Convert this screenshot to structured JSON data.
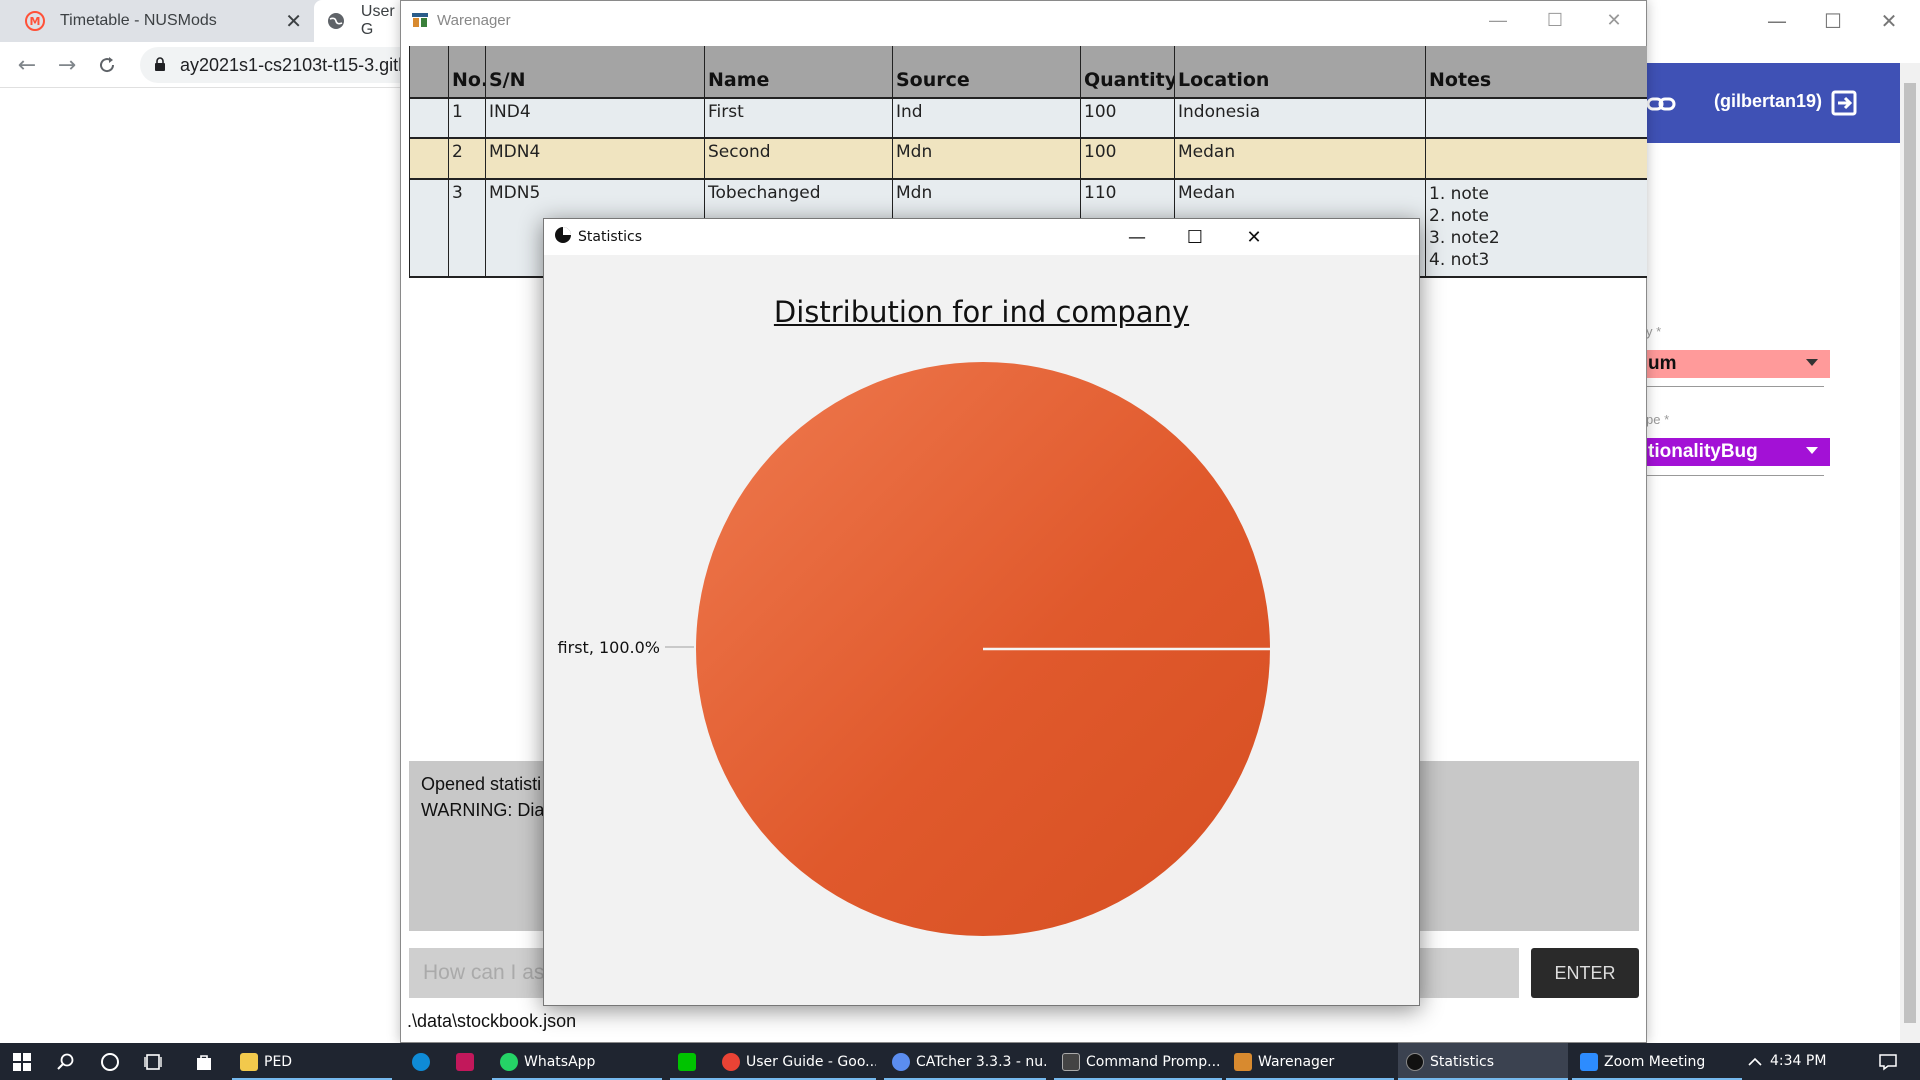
{
  "browser": {
    "tabs": [
      {
        "title": "Timetable - NUSMods",
        "close": "✕"
      },
      {
        "title": "User G"
      }
    ],
    "url": "ay2021s1-cs2103t-t15-3.githu",
    "github": {
      "user": "(gilbertan19)",
      "field1_label": "y *",
      "field1_value": "um",
      "field1_color": "#ff9a9a",
      "field2_label": "pe *",
      "field2_value": "tionalityBug",
      "field2_color": "#a311d6",
      "header_color": "#3f51b5"
    }
  },
  "warenager": {
    "title": "Warenager",
    "table": {
      "headers": [
        "",
        "No.",
        "S/N",
        "Name",
        "Source",
        "Quantity",
        "Location",
        "Notes"
      ],
      "rows": [
        {
          "no": "1",
          "sn": "IND4",
          "name": "First",
          "source": "Ind",
          "quantity": "100",
          "location": "Indonesia",
          "notes": ""
        },
        {
          "no": "2",
          "sn": "MDN4",
          "name": "Second",
          "source": "Mdn",
          "quantity": "100",
          "location": "Medan",
          "notes": ""
        },
        {
          "no": "3",
          "sn": "MDN5",
          "name": "Tobechanged",
          "source": "Mdn",
          "quantity": "110",
          "location": "Medan",
          "notes": "1. note\n2. note\n3. note2\n4. not3"
        }
      ]
    },
    "result_text": "Opened statisti\nWARNING: Dia",
    "command_placeholder": "How can I as",
    "enter_label": "ENTER",
    "status_path": ".\\data\\stockbook.json"
  },
  "statistics": {
    "window_title": "Statistics",
    "chart_data": {
      "type": "pie",
      "title": "Distribution for ind company",
      "slices": [
        {
          "label": "first",
          "value": 100.0,
          "display": "first, 100.0%",
          "color": "#e0592c"
        }
      ]
    }
  },
  "taskbar": {
    "apps": [
      {
        "label": "PED",
        "color": "#f2c94c"
      },
      {
        "label": "",
        "color": "#0f8bd6"
      },
      {
        "label": "",
        "color": "#c2185b"
      },
      {
        "label": "WhatsApp",
        "color": "#25d366"
      },
      {
        "label": "",
        "color": "#00c300"
      },
      {
        "label": "User Guide - Goo...",
        "color": "#ea4335"
      },
      {
        "label": "CATcher 3.3.3 - nu...",
        "color": "#5b8def"
      },
      {
        "label": "Command Promp...",
        "color": "#444444"
      },
      {
        "label": "Warenager",
        "color": "#d88a2f"
      },
      {
        "label": "Statistics",
        "color": "#111111"
      },
      {
        "label": "Zoom Meeting",
        "color": "#2d8cff"
      }
    ],
    "clock": "4:34 PM"
  }
}
